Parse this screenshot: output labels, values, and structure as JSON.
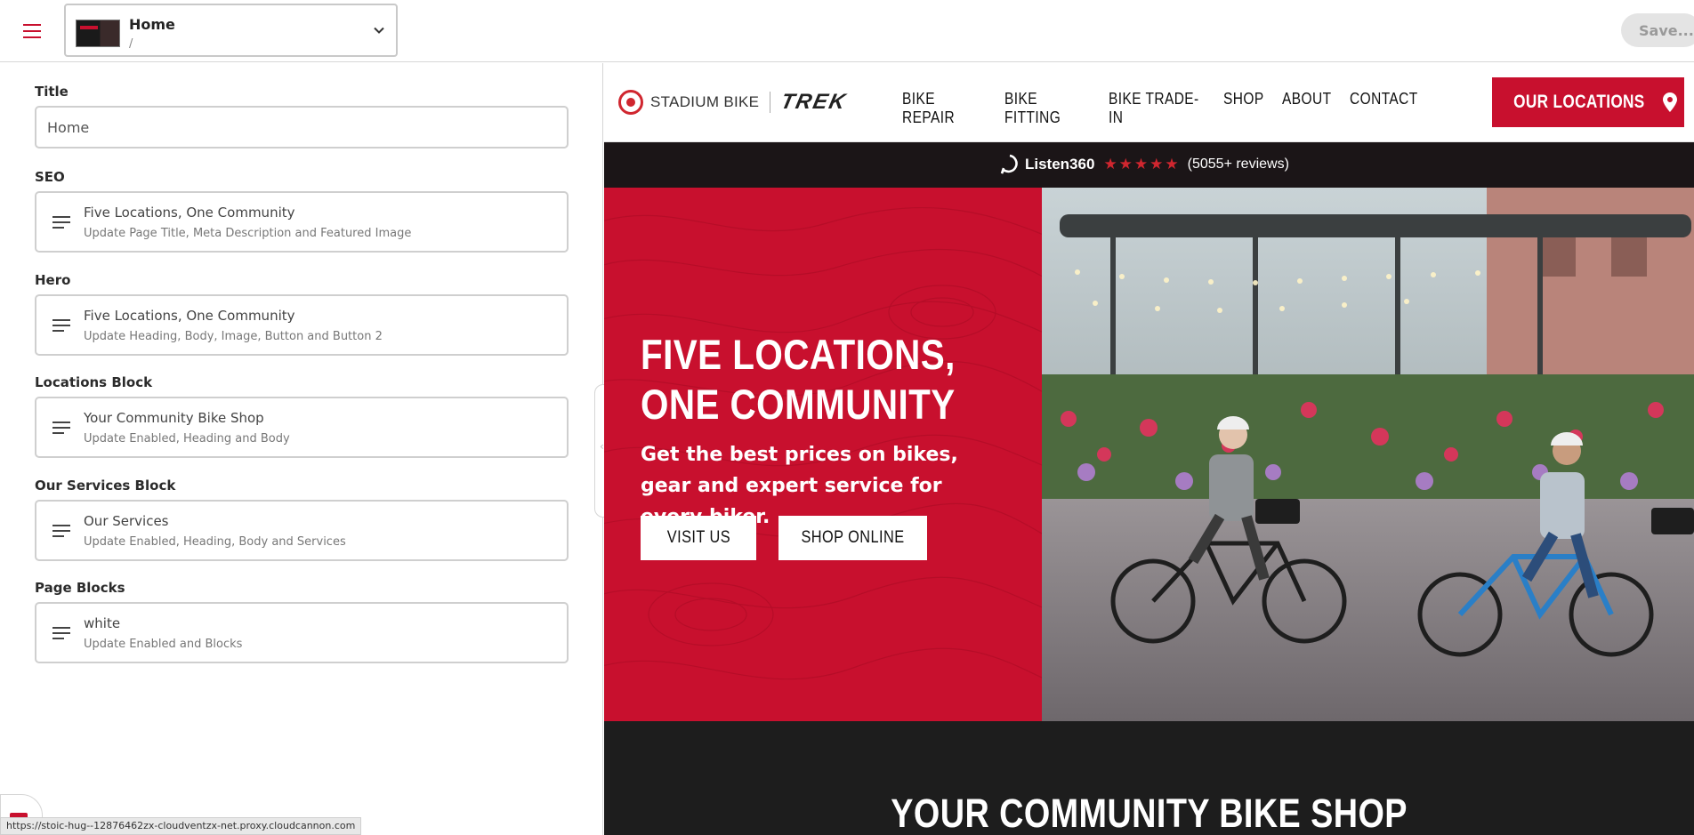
{
  "topbar": {
    "page_name": "Home",
    "page_path": "/",
    "save_label": "Save..."
  },
  "editor": {
    "title_label": "Title",
    "title_value": "Home",
    "sections": [
      {
        "label": "SEO",
        "title": "Five Locations, One Community",
        "subtitle": "Update Page Title, Meta Description and Featured Image"
      },
      {
        "label": "Hero",
        "title": "Five Locations, One Community",
        "subtitle": "Update Heading, Body, Image, Button and Button 2"
      },
      {
        "label": "Locations Block",
        "title": "Your Community Bike Shop",
        "subtitle": "Update Enabled, Heading and Body"
      },
      {
        "label": "Our Services Block",
        "title": "Our Services",
        "subtitle": "Update Enabled, Heading, Body and Services"
      },
      {
        "label": "Page Blocks",
        "title": "white",
        "subtitle": "Update Enabled and Blocks"
      }
    ]
  },
  "status_url": "https://stoic-hug--12876462zx-cloudventzx-net.proxy.cloudcannon.com",
  "site": {
    "brand": "STADIUM BIKE",
    "partner": "TREK",
    "nav": [
      "BIKE REPAIR",
      "BIKE FITTING",
      "BIKE TRADE-IN",
      "SHOP",
      "ABOUT",
      "CONTACT"
    ],
    "locations_button": "OUR LOCATIONS",
    "review_brand": "Listen360",
    "review_stars": "★★★★★",
    "review_count": "(5055+ reviews)",
    "hero_heading": "FIVE LOCATIONS, ONE COMMUNITY",
    "hero_body": "Get the best prices on bikes, gear and expert service for every biker.",
    "hero_button_1": "VISIT US",
    "hero_button_2": "SHOP ONLINE",
    "next_section_heading": "YOUR COMMUNITY BIKE SHOP"
  },
  "colors": {
    "brand_red": "#c8102e",
    "dark": "#1b1517"
  }
}
